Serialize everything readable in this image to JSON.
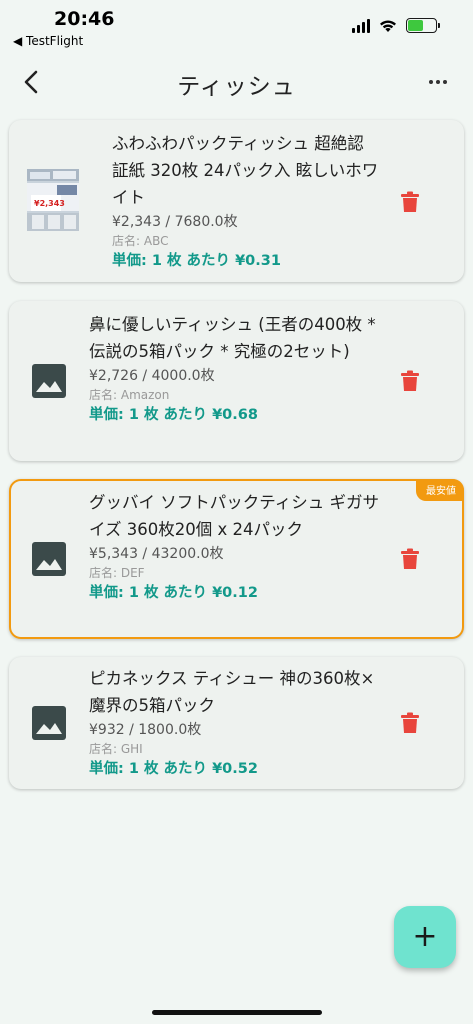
{
  "status_bar": {
    "time": "20:46",
    "back_app": "◀ TestFlight"
  },
  "nav": {
    "title": "ティッシュ",
    "back_icon": "chevron-left-icon",
    "more_icon": "more-horizontal-icon"
  },
  "items": [
    {
      "title": "ふわふわパックティッシュ 超絶認証紙 320枚 24パック入 眩しいホワイト",
      "price": "¥2,343 / 7680.0枚",
      "store": "店名: ABC",
      "unit_price": "単価: 1 枚 あたり ¥0.31",
      "thumbnail_price": "¥2,343",
      "has_photo": true,
      "best": false
    },
    {
      "title": "鼻に優しいティッシュ (王者の400枚 * 伝説の5箱パック * 究極の2セット)",
      "price": "¥2,726 / 4000.0枚",
      "store": "店名: Amazon",
      "unit_price": "単価: 1 枚 あたり ¥0.68",
      "has_photo": false,
      "best": false
    },
    {
      "title": "グッバイ ソフトパックティシュ ギガサイズ 360枚20個 x 24パック",
      "price": "¥5,343 / 43200.0枚",
      "store": "店名: DEF",
      "unit_price": "単価: 1 枚 あたり ¥0.12",
      "has_photo": false,
      "best": true,
      "badge": "最安値"
    },
    {
      "title": "ピカネックス ティシュー 神の360枚×魔界の5箱パック",
      "price": "¥932 / 1800.0枚",
      "store": "店名: GHI",
      "unit_price": "単価: 1 枚 あたり ¥0.52",
      "has_photo": false,
      "best": false
    }
  ],
  "fab": {
    "label": "+"
  },
  "colors": {
    "accent_teal": "#12998a",
    "best_orange": "#f29a10",
    "delete_red": "#e8453c",
    "fab_mint": "#6fe3cf"
  }
}
